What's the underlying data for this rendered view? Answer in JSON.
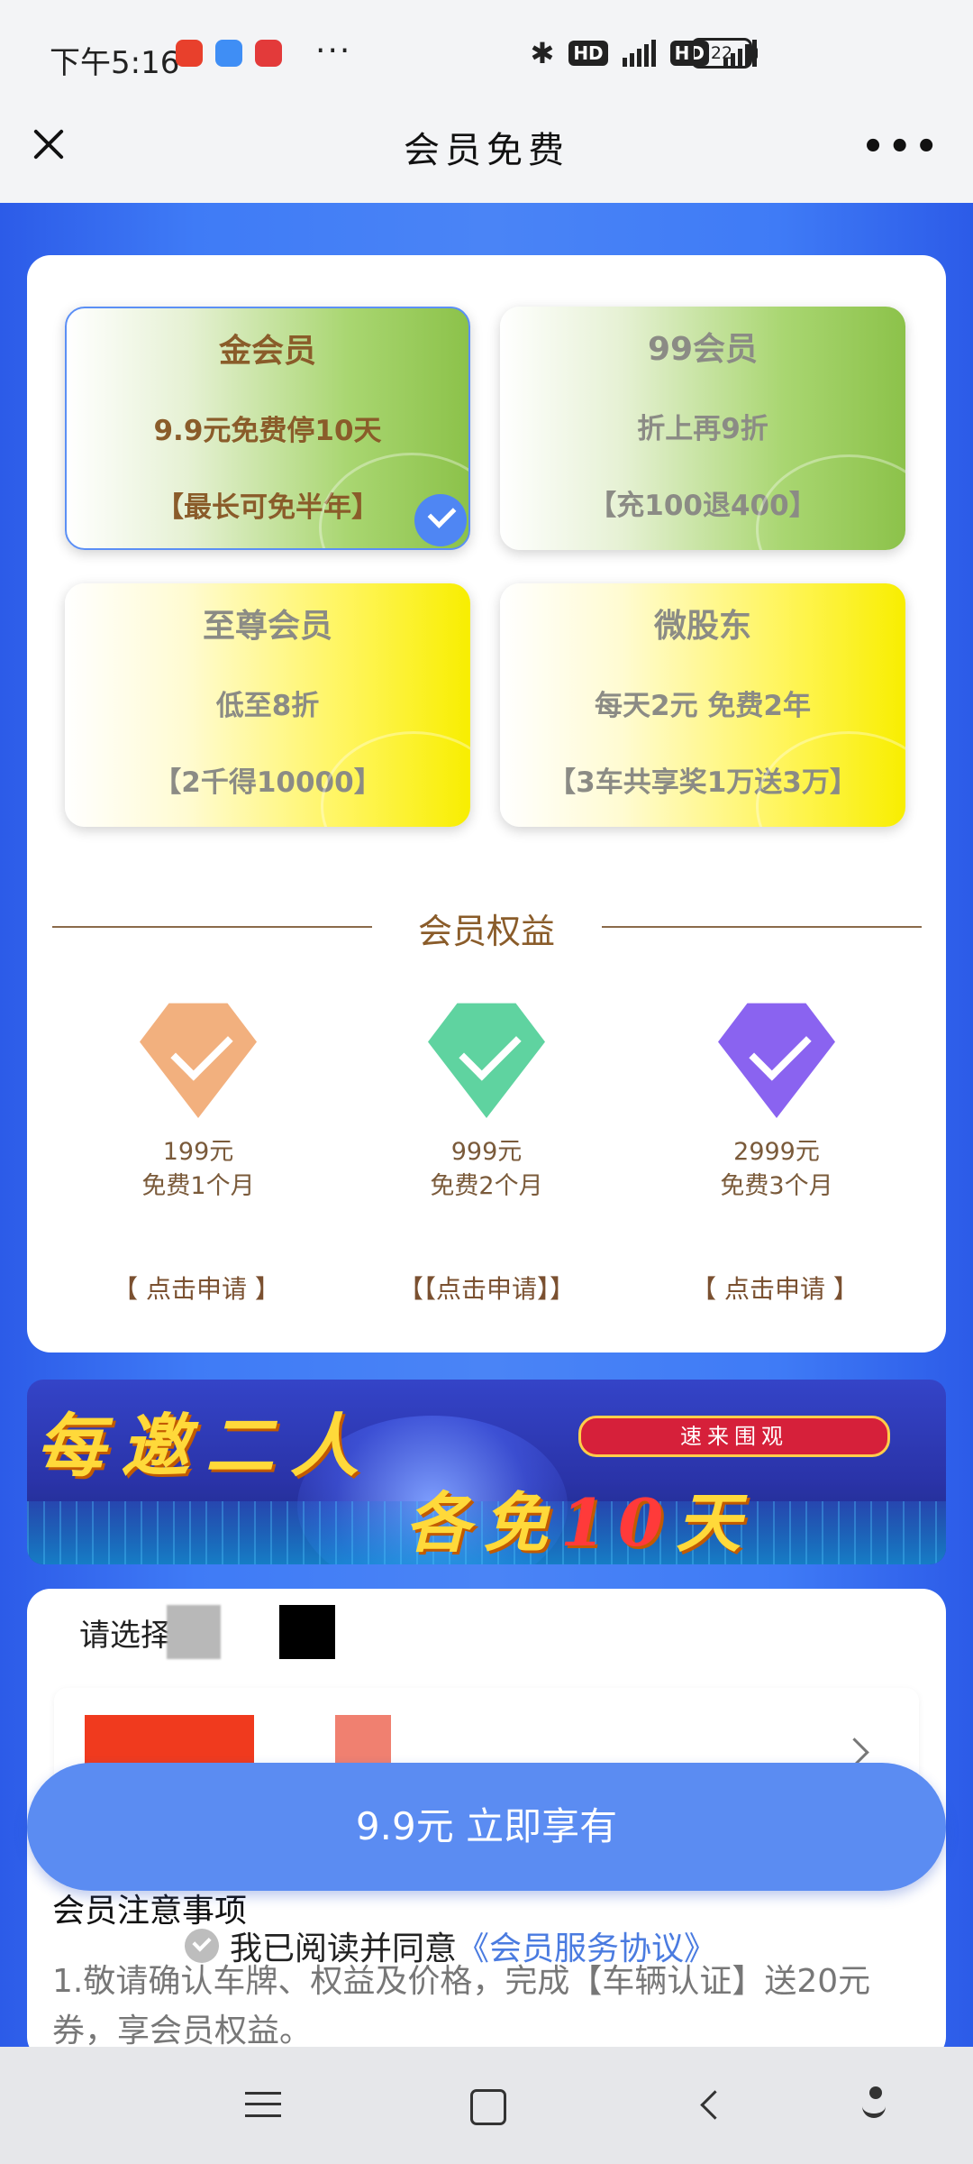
{
  "status": {
    "time": "下午5:16",
    "more": "···",
    "battery": "22",
    "hd1": "HD",
    "hd2": "HD",
    "colors": {
      "app1": "#e8402c",
      "app2": "#3f8ef5",
      "app3": "#e33a3a"
    }
  },
  "nav": {
    "title": "会员免费",
    "more": "•••"
  },
  "tiers": [
    {
      "name": "金会员",
      "offer": "9.9元免费停10天",
      "note": "【最长可免半年】",
      "selected": true
    },
    {
      "name": "99会员",
      "offer": "折上再9折",
      "note": "【充100退400】",
      "selected": false
    },
    {
      "name": "至尊会员",
      "offer": "低至8折",
      "note": "【2千得10000】",
      "selected": false
    },
    {
      "name": "微股东",
      "offer": "每天2元 免费2年",
      "note": "【3车共享奖1万送3万】",
      "selected": false
    }
  ],
  "benefits": {
    "title": "会员权益",
    "items": [
      {
        "price": "199元",
        "desc": "免费1个月",
        "apply": "【 点击申请 】",
        "color": "#f2b07e"
      },
      {
        "price": "999元",
        "desc": "免费2个月",
        "apply": "【【点击申请】】",
        "color": "#5fd3a0"
      },
      {
        "price": "2999元",
        "desc": "免费3个月",
        "apply": "【 点击申请 】",
        "color": "#8a63f0"
      }
    ]
  },
  "banner": {
    "line1": "每邀二人",
    "line2_a": "各免",
    "line2_ten": "10",
    "line2_b": "天",
    "tag": "速来围观"
  },
  "plate": {
    "label": "请选择"
  },
  "cta": {
    "label": "9.9元 立即享有"
  },
  "agreement": {
    "prefix": "我已阅读并同意",
    "link": "《会员服务协议》"
  },
  "notice": {
    "title": "会员注意事项",
    "text": "1.敬请确认车牌、权益及价格，完成【车辆认证】送20元券，享会员权益。"
  }
}
